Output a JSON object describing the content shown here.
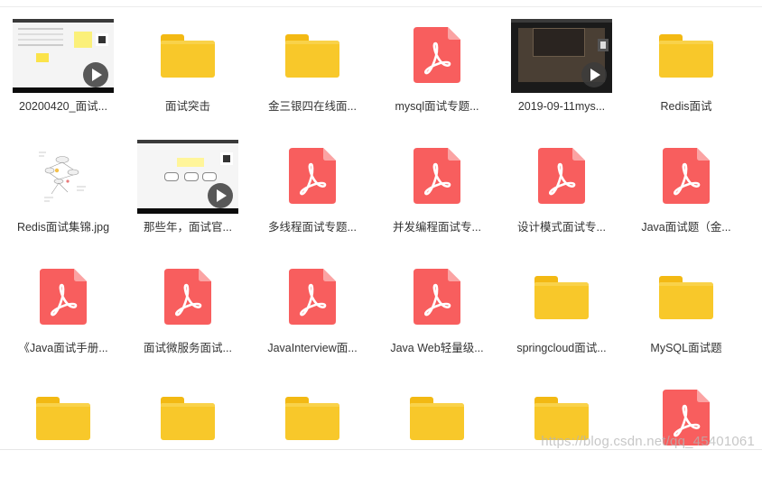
{
  "colors": {
    "folder": "#f8c82a",
    "pdf": "#f85e5e",
    "label": "#333333"
  },
  "files": [
    {
      "type": "video",
      "variant": "vid-a",
      "icon": "video-thumbnail-icon",
      "label": "20200420_面试..."
    },
    {
      "type": "folder",
      "icon": "folder-icon",
      "label": "面试突击"
    },
    {
      "type": "folder",
      "icon": "folder-icon",
      "label": "金三银四在线面..."
    },
    {
      "type": "pdf",
      "icon": "pdf-file-icon",
      "label": "mysql面试专题..."
    },
    {
      "type": "video",
      "variant": "vid-b",
      "icon": "video-thumbnail-icon",
      "label": "2019-09-11mys..."
    },
    {
      "type": "folder",
      "icon": "folder-icon",
      "label": "Redis面试"
    },
    {
      "type": "image",
      "icon": "image-thumbnail-icon",
      "label": "Redis面试集锦.jpg"
    },
    {
      "type": "video",
      "variant": "vid-c",
      "icon": "video-thumbnail-icon",
      "label": "那些年，面试官..."
    },
    {
      "type": "pdf",
      "icon": "pdf-file-icon",
      "label": "多线程面试专题..."
    },
    {
      "type": "pdf",
      "icon": "pdf-file-icon",
      "label": "并发编程面试专..."
    },
    {
      "type": "pdf",
      "icon": "pdf-file-icon",
      "label": "设计模式面试专..."
    },
    {
      "type": "pdf",
      "icon": "pdf-file-icon",
      "label": "Java面试题（金..."
    },
    {
      "type": "pdf",
      "icon": "pdf-file-icon",
      "label": "《Java面试手册..."
    },
    {
      "type": "pdf",
      "icon": "pdf-file-icon",
      "label": "面试微服务面试..."
    },
    {
      "type": "pdf",
      "icon": "pdf-file-icon",
      "label": "JavaInterview面..."
    },
    {
      "type": "pdf",
      "icon": "pdf-file-icon",
      "label": "Java Web轻量级..."
    },
    {
      "type": "folder",
      "icon": "folder-icon",
      "label": "springcloud面试..."
    },
    {
      "type": "folder",
      "icon": "folder-icon",
      "label": "MySQL面试题"
    },
    {
      "type": "folder",
      "icon": "folder-icon",
      "label": ""
    },
    {
      "type": "folder",
      "icon": "folder-icon",
      "label": ""
    },
    {
      "type": "folder",
      "icon": "folder-icon",
      "label": ""
    },
    {
      "type": "folder",
      "icon": "folder-icon",
      "label": ""
    },
    {
      "type": "folder",
      "icon": "folder-icon",
      "label": ""
    },
    {
      "type": "pdf",
      "icon": "pdf-file-icon",
      "label": ""
    }
  ],
  "watermark": "https://blog.csdn.net/qq_45401061"
}
